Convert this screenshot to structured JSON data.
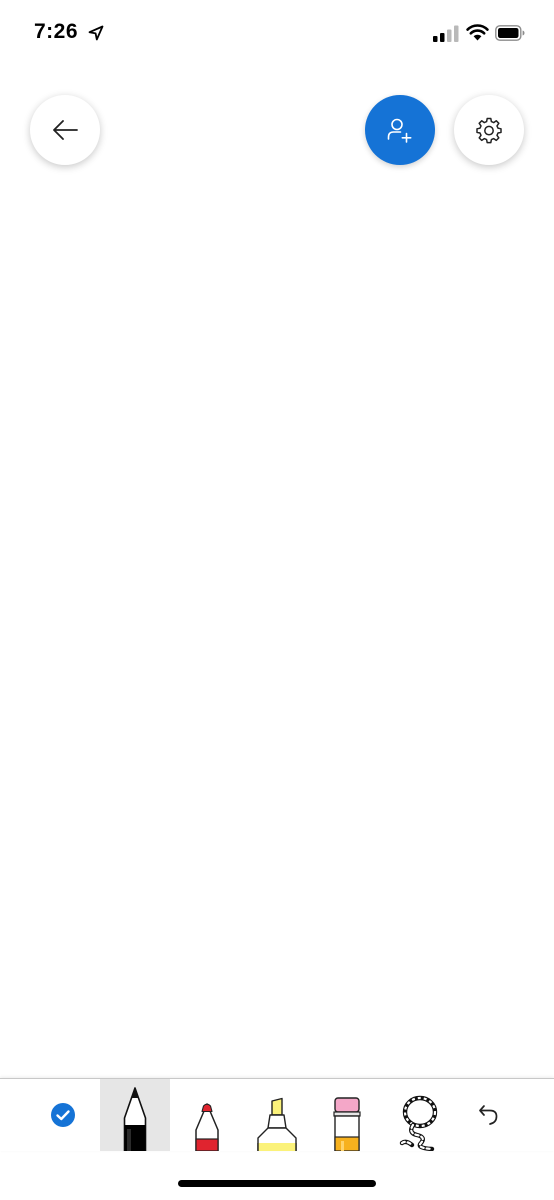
{
  "status_bar": {
    "time": "7:26",
    "location_icon": "location-arrow-icon",
    "signal_icon": "cellular-signal-icon",
    "wifi_icon": "wifi-icon",
    "battery_icon": "battery-icon"
  },
  "header": {
    "back_icon": "arrow-left-icon",
    "invite_icon": "person-add-icon",
    "settings_icon": "gear-icon"
  },
  "colors": {
    "accent": "#1573d6",
    "pen": "#000000",
    "marker": "#e0242f",
    "highlighter": "#fbf27a",
    "eraser": "#f4a7c8",
    "selected_tool_bg": "#e6e6e6"
  },
  "toolbar": {
    "tools": [
      {
        "name": "done",
        "icon": "checkmark-circle-icon",
        "selected": false
      },
      {
        "name": "pen",
        "icon": "pen-icon",
        "selected": true
      },
      {
        "name": "marker",
        "icon": "marker-icon",
        "selected": false
      },
      {
        "name": "highlighter",
        "icon": "highlighter-icon",
        "selected": false
      },
      {
        "name": "eraser",
        "icon": "eraser-icon",
        "selected": false
      },
      {
        "name": "lasso",
        "icon": "lasso-icon",
        "selected": false
      },
      {
        "name": "undo",
        "icon": "undo-icon",
        "selected": false
      }
    ]
  }
}
